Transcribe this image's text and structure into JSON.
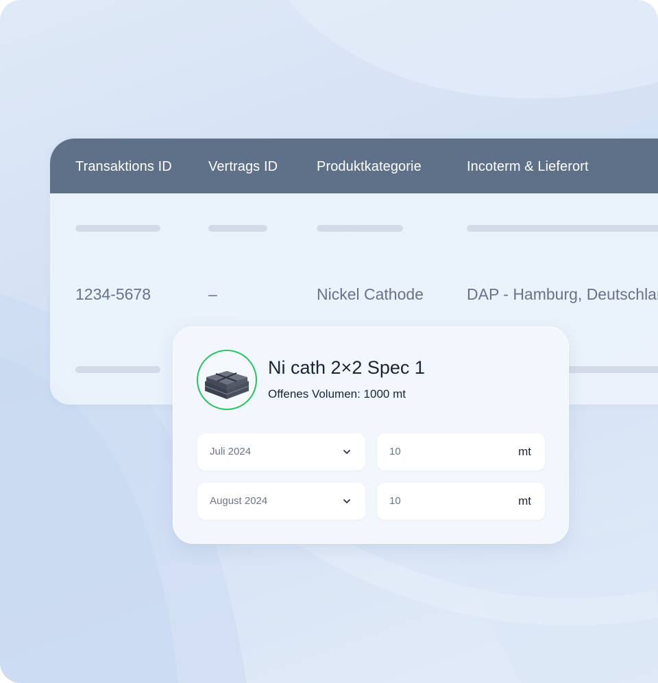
{
  "table": {
    "headers": [
      "Transaktions ID",
      "Vertrags ID",
      "Produktkategorie",
      "Incoterm & Lieferort"
    ],
    "row": {
      "transaction_id": "1234-5678",
      "contract_id": "–",
      "category": "Nickel Cathode",
      "incoterm": "DAP - Hamburg, Deutschland"
    }
  },
  "popup": {
    "product_icon": "nickel-cathode-stack-image",
    "title": "Ni cath 2×2 Spec 1",
    "volume": "Offenes Volumen: 1000 mt",
    "schedule": [
      {
        "month": "Juli 2024",
        "quantity": "10",
        "unit": "mt"
      },
      {
        "month": "August 2024",
        "quantity": "10",
        "unit": "mt"
      }
    ]
  },
  "colors": {
    "header_bg": "#5f7089",
    "accent_ring": "#22c55e",
    "text_dark": "#1b2434",
    "text_muted": "#66738a"
  }
}
